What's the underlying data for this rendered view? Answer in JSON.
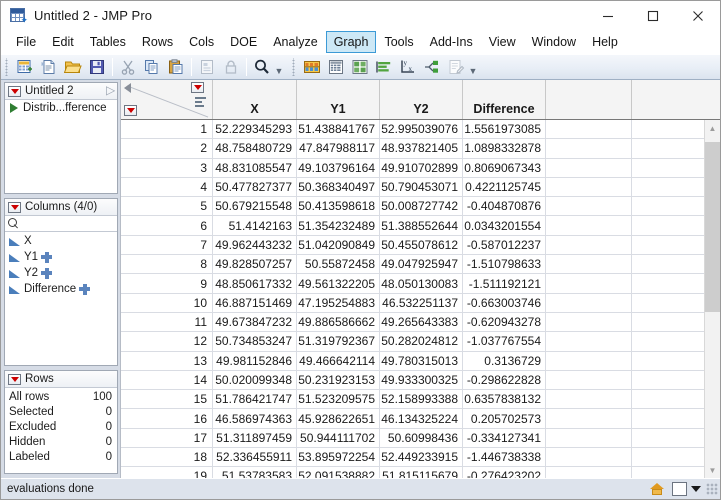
{
  "window": {
    "title": "Untitled 2 - JMP Pro",
    "icon": "jmp-datatable-icon",
    "minimize": "minimize-icon",
    "maximize": "maximize-icon",
    "close": "close-icon"
  },
  "menu": {
    "items": [
      {
        "label": "File",
        "active": false
      },
      {
        "label": "Edit",
        "active": false
      },
      {
        "label": "Tables",
        "active": false
      },
      {
        "label": "Rows",
        "active": false
      },
      {
        "label": "Cols",
        "active": false
      },
      {
        "label": "DOE",
        "active": false
      },
      {
        "label": "Analyze",
        "active": false
      },
      {
        "label": "Graph",
        "active": true
      },
      {
        "label": "Tools",
        "active": false
      },
      {
        "label": "Add-Ins",
        "active": false
      },
      {
        "label": "View",
        "active": false
      },
      {
        "label": "Window",
        "active": false
      },
      {
        "label": "Help",
        "active": false
      }
    ]
  },
  "toolbar": {
    "group1": [
      "new-data-table-icon",
      "new-script-icon",
      "open-icon",
      "save-icon"
    ],
    "group2": [
      "cut-icon",
      "copy-icon",
      "paste-icon"
    ],
    "group3": [
      "journal-icon",
      "lock-icon"
    ],
    "group4": [
      "search-icon"
    ],
    "group5": [
      "distribution-icon",
      "fit-y-by-x-icon",
      "tabulate-icon",
      "bar-chart-icon",
      "fit-model-icon",
      "partition-icon",
      "script-editor-icon"
    ],
    "overflow": "toolbar-overflow-icon"
  },
  "sidebar": {
    "tables_panel": {
      "title": "Untitled 2",
      "menu_icon": "red-triangle-menu",
      "open_icon": "open-arrow-icon",
      "items": [
        {
          "label": "Distrib...fference",
          "icon": "green-run-triangle"
        }
      ]
    },
    "columns_panel": {
      "title": "Columns (4/0)",
      "menu_icon": "red-triangle-menu",
      "search_icon": "search-icon",
      "search_value": "",
      "columns": [
        {
          "name": "X",
          "type_icon": "continuous-icon",
          "formula": false
        },
        {
          "name": "Y1",
          "type_icon": "continuous-icon",
          "formula": true
        },
        {
          "name": "Y2",
          "type_icon": "continuous-icon",
          "formula": true
        },
        {
          "name": "Difference",
          "type_icon": "continuous-icon",
          "formula": true
        }
      ]
    },
    "rows_panel": {
      "title": "Rows",
      "menu_icon": "red-triangle-menu",
      "rows": [
        {
          "label": "All rows",
          "value": "100"
        },
        {
          "label": "Selected",
          "value": "0"
        },
        {
          "label": "Excluded",
          "value": "0"
        },
        {
          "label": "Hidden",
          "value": "0"
        },
        {
          "label": "Labeled",
          "value": "0"
        }
      ]
    }
  },
  "grid": {
    "corner": {
      "collapse_icon": "left-triangle-icon",
      "table_menu_icon": "red-triangle-menu",
      "rows_menu_icon": "red-triangle-menu",
      "bars_icon": "row-state-bars-icon"
    },
    "columns": [
      "X",
      "Y1",
      "Y2",
      "Difference"
    ],
    "rows": [
      {
        "n": "1",
        "X": "52.229345293",
        "Y1": "51.438841767",
        "Y2": "52.995039076",
        "Difference": "1.5561973085"
      },
      {
        "n": "2",
        "X": "48.758480729",
        "Y1": "47.847988117",
        "Y2": "48.937821405",
        "Difference": "1.0898332878"
      },
      {
        "n": "3",
        "X": "48.831085547",
        "Y1": "49.103796164",
        "Y2": "49.910702899",
        "Difference": "0.8069067343"
      },
      {
        "n": "4",
        "X": "50.477827377",
        "Y1": "50.368340497",
        "Y2": "50.790453071",
        "Difference": "0.4221125745"
      },
      {
        "n": "5",
        "X": "50.679215548",
        "Y1": "50.413598618",
        "Y2": "50.008727742",
        "Difference": "-0.404870876"
      },
      {
        "n": "6",
        "X": "51.4142163",
        "Y1": "51.354232489",
        "Y2": "51.388552644",
        "Difference": "0.0343201554"
      },
      {
        "n": "7",
        "X": "49.962443232",
        "Y1": "51.042090849",
        "Y2": "50.455078612",
        "Difference": "-0.587012237"
      },
      {
        "n": "8",
        "X": "49.828507257",
        "Y1": "50.55872458",
        "Y2": "49.047925947",
        "Difference": "-1.510798633"
      },
      {
        "n": "9",
        "X": "48.850617332",
        "Y1": "49.561322205",
        "Y2": "48.050130083",
        "Difference": "-1.511192121"
      },
      {
        "n": "10",
        "X": "46.887151469",
        "Y1": "47.195254883",
        "Y2": "46.532251137",
        "Difference": "-0.663003746"
      },
      {
        "n": "11",
        "X": "49.673847232",
        "Y1": "49.886586662",
        "Y2": "49.265643383",
        "Difference": "-0.620943278"
      },
      {
        "n": "12",
        "X": "50.734853247",
        "Y1": "51.319792367",
        "Y2": "50.282024812",
        "Difference": "-1.037767554"
      },
      {
        "n": "13",
        "X": "49.981152846",
        "Y1": "49.466642114",
        "Y2": "49.780315013",
        "Difference": "0.3136729"
      },
      {
        "n": "14",
        "X": "50.020099348",
        "Y1": "50.231923153",
        "Y2": "49.933300325",
        "Difference": "-0.298622828"
      },
      {
        "n": "15",
        "X": "51.786421747",
        "Y1": "51.523209575",
        "Y2": "52.158993388",
        "Difference": "0.6357838132"
      },
      {
        "n": "16",
        "X": "46.586974363",
        "Y1": "45.928622651",
        "Y2": "46.134325224",
        "Difference": "0.205702573"
      },
      {
        "n": "17",
        "X": "51.311897459",
        "Y1": "50.944111702",
        "Y2": "50.60998436",
        "Difference": "-0.334127341"
      },
      {
        "n": "18",
        "X": "52.336455911",
        "Y1": "53.895972254",
        "Y2": "52.449233915",
        "Difference": "-1.446738338"
      },
      {
        "n": "19",
        "X": "51.53783583",
        "Y1": "52.091538882",
        "Y2": "51.815115679",
        "Difference": "-0.276423202"
      }
    ],
    "scrollbar": {
      "up_icon": "scroll-up-icon",
      "down_icon": "scroll-down-icon"
    }
  },
  "statusbar": {
    "message": "evaluations done",
    "home_icon": "home-icon",
    "preview_box": "white-box-icon",
    "dropdown_icon": "caret-down-icon",
    "resize_grip": "resize-grip-icon"
  },
  "colors": {
    "menu_active_bg": "#cde8f6",
    "menu_active_border": "#3c9ad6",
    "panel_bg": "#d6dce6",
    "statusbar_bg": "#dde3ec",
    "red_triangle": "#cc0000",
    "column_icon": "#4a7ebb"
  }
}
